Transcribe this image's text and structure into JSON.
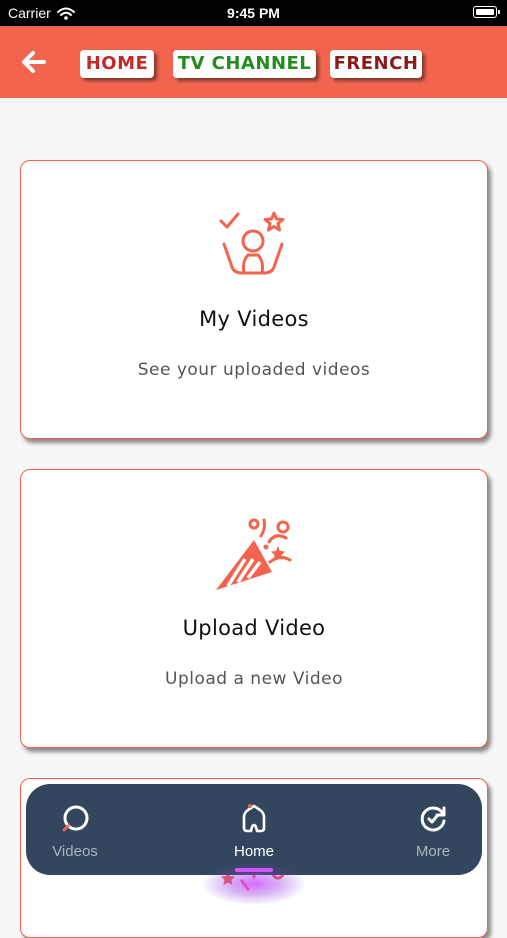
{
  "status_bar": {
    "carrier": "Carrier",
    "time": "9:45 PM"
  },
  "app_bar": {
    "chips": {
      "home": "HOME",
      "tv_channel": "TV CHANNEL",
      "french": "FRENCH"
    }
  },
  "cards": [
    {
      "title": "My Videos",
      "subtitle": "See your uploaded videos",
      "icon": "celebrate-person-icon"
    },
    {
      "title": "Upload Video",
      "subtitle": "Upload a new Video",
      "icon": "party-popper-icon"
    },
    {
      "title": "",
      "subtitle": "",
      "icon": "party-popper-icon"
    }
  ],
  "bottom_nav": {
    "items": [
      {
        "label": "Videos",
        "icon": "search-icon"
      },
      {
        "label": "Home",
        "icon": "home-icon",
        "active": true
      },
      {
        "label": "More",
        "icon": "refresh-icon"
      }
    ]
  },
  "colors": {
    "accent": "#f2644e",
    "nav_bg": "#32475e",
    "active_glow": "#d455ff"
  }
}
